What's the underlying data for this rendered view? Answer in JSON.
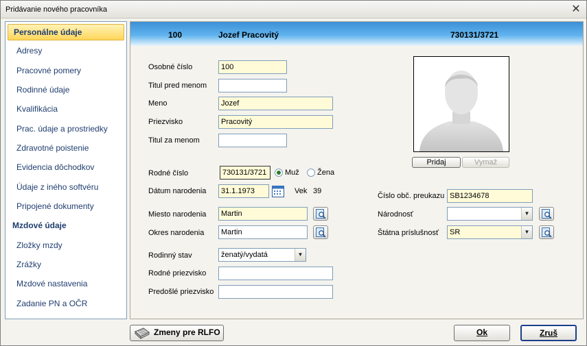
{
  "window": {
    "title": "Pridávanie nového pracovníka",
    "close_glyph": "✕"
  },
  "sidebar": {
    "items": [
      {
        "label": "Personálne údaje",
        "active": true
      },
      {
        "label": "Adresy"
      },
      {
        "label": "Pracovné pomery"
      },
      {
        "label": "Rodinné údaje"
      },
      {
        "label": "Kvalifikácia"
      },
      {
        "label": "Prac. údaje a prostriedky"
      },
      {
        "label": "Zdravotné poistenie"
      },
      {
        "label": "Evidencia dôchodkov"
      },
      {
        "label": "Údaje z iného softvéru"
      },
      {
        "label": "Pripojené dokumenty"
      }
    ],
    "section_label": "Mzdové údaje",
    "section_items": [
      {
        "label": "Zložky mzdy"
      },
      {
        "label": "Zrážky"
      },
      {
        "label": "Mzdové nastavenia"
      },
      {
        "label": "Zadanie PN a OČR"
      }
    ]
  },
  "header": {
    "id": "100",
    "name": "Jozef Pracovitý",
    "birth_number": "730131/3721"
  },
  "form": {
    "osobne_cislo": {
      "label": "Osobné číslo",
      "value": "100"
    },
    "titul_pred": {
      "label": "Titul pred menom",
      "value": ""
    },
    "meno": {
      "label": "Meno",
      "value": "Jozef"
    },
    "priezvisko": {
      "label": "Priezvisko",
      "value": "Pracovitý"
    },
    "titul_za": {
      "label": "Titul za menom",
      "value": ""
    },
    "rodne_cislo": {
      "label": "Rodné číslo",
      "value": "730131/3721"
    },
    "gender": {
      "male": "Muž",
      "female": "Žena",
      "selected": "male"
    },
    "datum_narodenia": {
      "label": "Dátum narodenia",
      "value": "31.1.1973"
    },
    "vek": {
      "label": "Vek",
      "value": "39"
    },
    "miesto_narodenia": {
      "label": "Miesto narodenia",
      "value": "Martin"
    },
    "okres_narodenia": {
      "label": "Okres narodenia",
      "value": "Martin"
    },
    "rodinny_stav": {
      "label": "Rodinný stav",
      "value": "ženatý/vydatá"
    },
    "rodne_priezvisko": {
      "label": "Rodné priezvisko",
      "value": ""
    },
    "predosle_priezvisko": {
      "label": "Predošlé priezvisko",
      "value": ""
    },
    "cislo_preukazu": {
      "label": "Číslo obč. preukazu",
      "value": "SB1234678"
    },
    "narodnost": {
      "label": "Národnosť",
      "value": ""
    },
    "statna_prislusnost": {
      "label": "Štátna príslušnosť",
      "value": "SR"
    }
  },
  "photo": {
    "add_label": "Pridaj",
    "remove_label": "Vymaž"
  },
  "footer": {
    "rlfo_label": "Zmeny pre RLFO",
    "ok_label": "Ok",
    "cancel_label": "Zruš"
  },
  "colors": {
    "required_field": "#fffbd8",
    "header_blue": "#3c90d6",
    "active_nav": "#ffd65a"
  }
}
